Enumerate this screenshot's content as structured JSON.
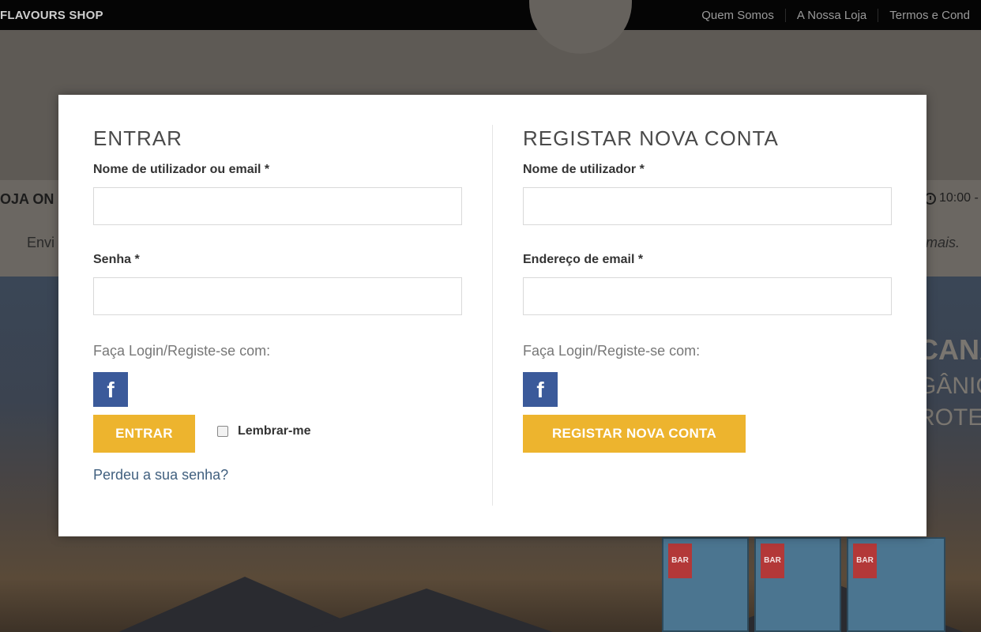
{
  "topbar": {
    "brand": "FLAVOURS SHOP",
    "nav": [
      "Quem Somos",
      "A Nossa Loja",
      "Termos e Cond"
    ]
  },
  "background": {
    "band_left": "OJA ON",
    "band_left_sub": "Envi",
    "band_right_time": "10:00 -",
    "band_right_sub": "mais.",
    "hero_lines": [
      "CANA",
      "GÂNIC",
      "ROTEI"
    ],
    "bar_label": "BAR"
  },
  "login": {
    "title": "ENTRAR",
    "username_label": "Nome de utilizador ou email *",
    "username_value": "",
    "password_label": "Senha *",
    "password_value": "",
    "social_label": "Faça Login/Registe-se com:",
    "social_icon": "facebook-icon",
    "submit_label": "ENTRAR",
    "remember_label": "Lembrar-me",
    "remember_checked": false,
    "lost_password": "Perdeu a sua senha?"
  },
  "register": {
    "title": "REGISTAR NOVA CONTA",
    "username_label": "Nome de utilizador *",
    "username_value": "",
    "email_label": "Endereço de email *",
    "email_value": "",
    "social_label": "Faça Login/Registe-se com:",
    "social_icon": "facebook-icon",
    "submit_label": "REGISTAR NOVA CONTA"
  },
  "colors": {
    "accent_button": "#edb42e",
    "facebook": "#3b5a9a",
    "link": "#41607f"
  }
}
